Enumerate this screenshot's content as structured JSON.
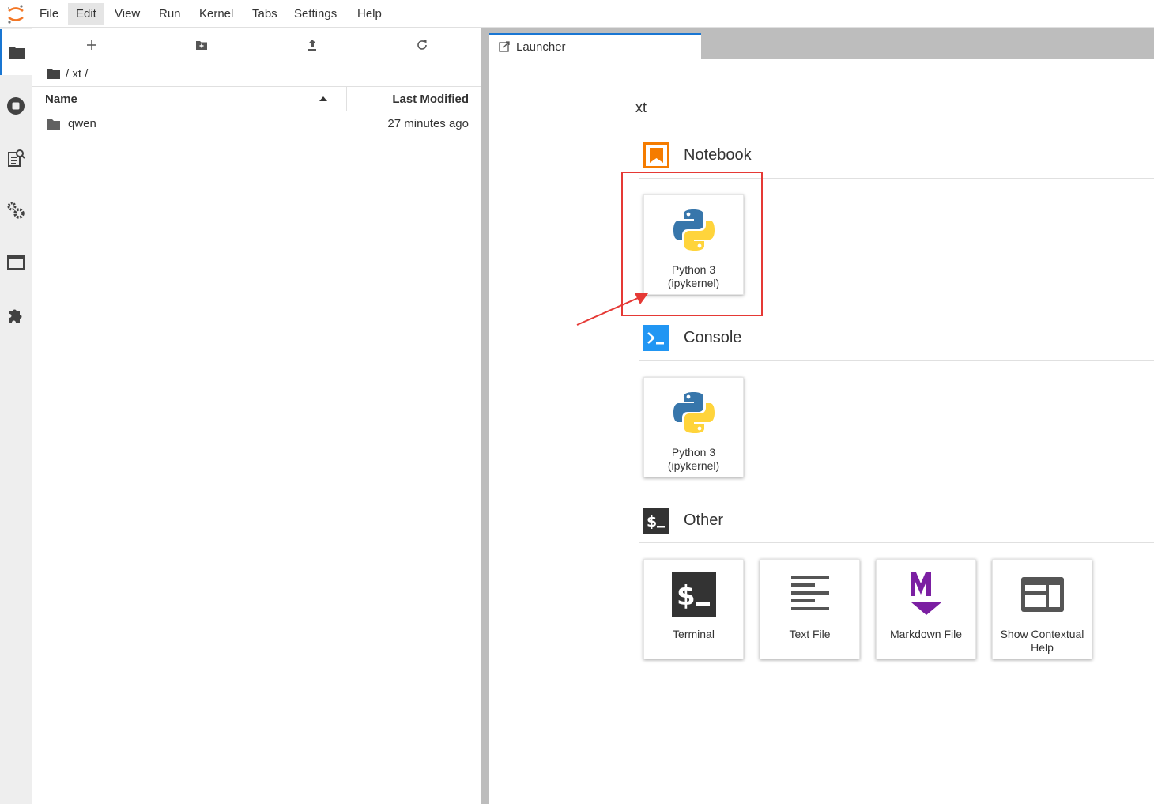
{
  "menubar": {
    "items": [
      "File",
      "Edit",
      "View",
      "Run",
      "Kernel",
      "Tabs",
      "Settings",
      "Help"
    ],
    "active": "Edit"
  },
  "activitybar": {
    "icons": [
      "folder-icon",
      "stop-circle-icon",
      "property-inspector-icon",
      "extension-settings-icon",
      "tabs-icon",
      "puzzle-icon"
    ]
  },
  "filebrowser": {
    "breadcrumb": "/ xt /",
    "columns": {
      "name": "Name",
      "modified": "Last Modified"
    },
    "rows": [
      {
        "name": "qwen",
        "modified": "27 minutes ago",
        "type": "folder"
      }
    ]
  },
  "tabs": [
    {
      "label": "Launcher"
    }
  ],
  "launcher": {
    "cwd": "xt",
    "sections": [
      {
        "title": "Notebook",
        "cards": [
          {
            "label": "Python 3 (ipykernel)"
          }
        ]
      },
      {
        "title": "Console",
        "cards": [
          {
            "label": "Python 3 (ipykernel)"
          }
        ]
      },
      {
        "title": "Other",
        "cards": [
          {
            "label": "Terminal"
          },
          {
            "label": "Text File"
          },
          {
            "label": "Markdown File"
          },
          {
            "label": "Show Contextual Help"
          }
        ]
      }
    ]
  },
  "colors": {
    "accent": "#1976d2",
    "notebook": "#f57c00",
    "console": "#2196f3",
    "markdown": "#7b1fa2",
    "annotation": "#e53935"
  }
}
